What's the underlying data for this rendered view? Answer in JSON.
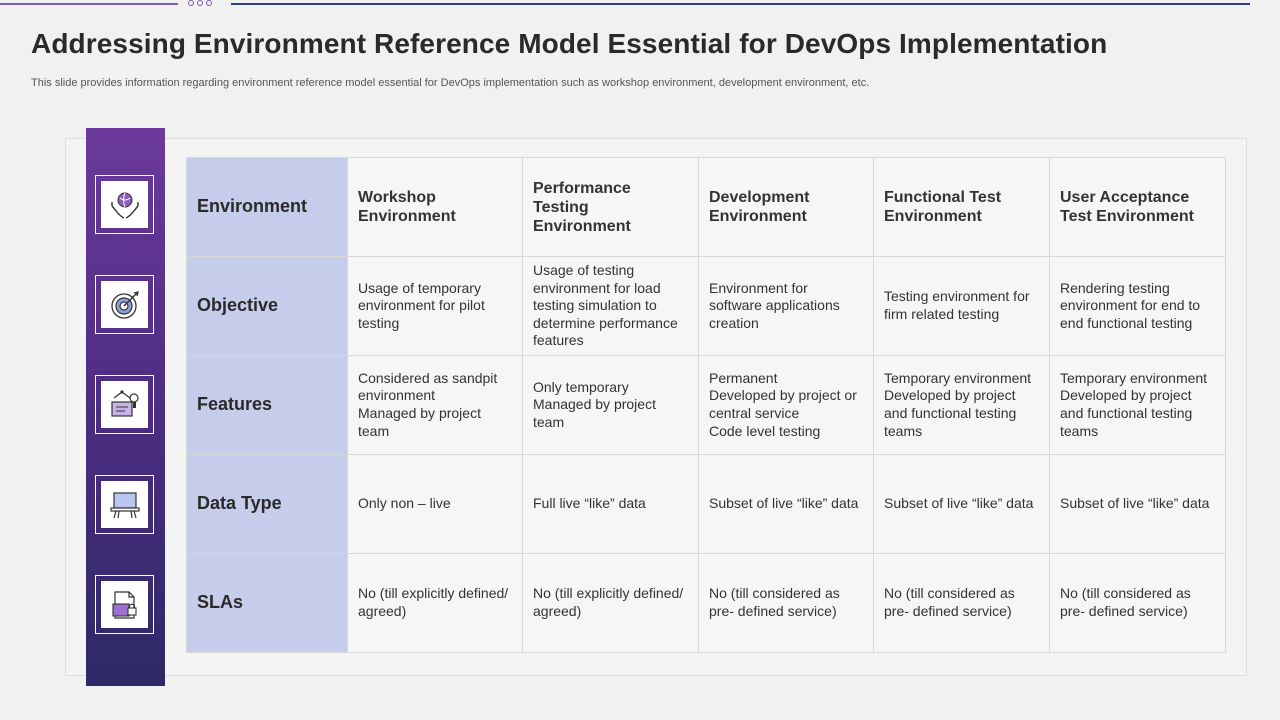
{
  "title": "Addressing Environment Reference Model Essential for DevOps Implementation",
  "subtitle": "This slide provides information regarding environment reference model essential for DevOps implementation such as workshop environment, development environment, etc.",
  "colors": {
    "sidebar_top": "#6b3a9c",
    "sidebar_bottom": "#2c2a66",
    "row_header_bg": "#c5cdea",
    "accent_line": "#2d3b8a"
  },
  "sidebar_icons": [
    "globe-hands-icon",
    "target-icon",
    "design-tools-icon",
    "laptop-hands-icon",
    "document-lock-icon"
  ],
  "table": {
    "row_headers": [
      "Environment",
      "Objective",
      "Features",
      "Data Type",
      "SLAs"
    ],
    "columns": [
      {
        "header": "Workshop Environment",
        "objective": "Usage of temporary environment for pilot testing",
        "features": [
          "Considered as sandpit environment",
          "Managed by project team"
        ],
        "data_type": "Only non – live",
        "slas": "No (till explicitly defined/ agreed)"
      },
      {
        "header": "Performance Testing Environment",
        "objective": "Usage of testing environment for load testing simulation to determine performance features",
        "features": [
          "Only temporary",
          "Managed by project team"
        ],
        "data_type": "Full live “like” data",
        "slas": "No (till explicitly defined/ agreed)"
      },
      {
        "header": "Development Environment",
        "objective": "Environment for software applications creation",
        "features": [
          "Permanent",
          "Developed by project or central service",
          "Code level testing"
        ],
        "data_type": "Subset of live “like” data",
        "slas": "No (till considered as pre- defined service)"
      },
      {
        "header": "Functional Test Environment",
        "objective": "Testing environment for firm related testing",
        "features": [
          "Temporary environment",
          "Developed by project and functional testing teams"
        ],
        "data_type": "Subset of live “like” data",
        "slas": "No (till considered as pre- defined service)"
      },
      {
        "header": "User Acceptance Test Environment",
        "objective": "Rendering testing environment for end to end functional testing",
        "features": [
          "Temporary environment",
          "Developed by project and functional testing teams"
        ],
        "data_type": "Subset of live “like” data",
        "slas": "No (till considered as pre- defined service)"
      }
    ]
  }
}
